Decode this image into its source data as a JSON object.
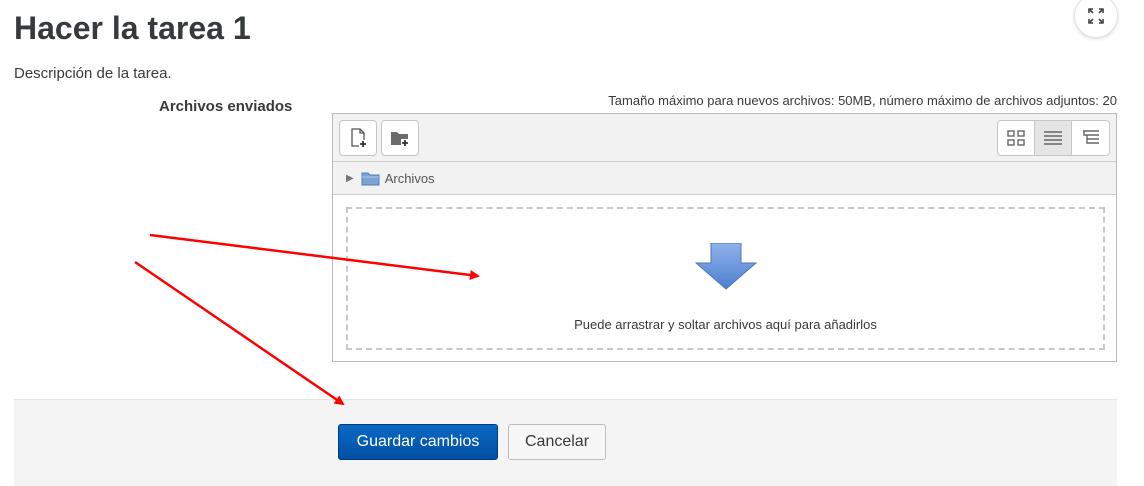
{
  "page": {
    "title": "Hacer la tarea 1",
    "description": "Descripción de la tarea.",
    "fullscreen_icon": "expand-icon"
  },
  "form": {
    "field_label": "Archivos enviados",
    "max_size_note": "Tamaño máximo para nuevos archivos: 50MB, número máximo de archivos adjuntos: 20"
  },
  "filemanager": {
    "toolbar": {
      "add_file_icon": "add-file-icon",
      "create_folder_icon": "create-folder-icon",
      "views": [
        {
          "icon": "view-icons-icon",
          "active": false
        },
        {
          "icon": "view-list-icon",
          "active": true
        },
        {
          "icon": "view-tree-icon",
          "active": false
        }
      ]
    },
    "path": {
      "folder_label": "Archivos"
    },
    "dropzone": {
      "text": "Puede arrastrar y soltar archivos aquí para añadirlos"
    }
  },
  "buttons": {
    "save_label": "Guardar cambios",
    "cancel_label": "Cancelar"
  },
  "colors": {
    "primary": "#0a68c4",
    "annotation_arrow": "#ff0000"
  }
}
